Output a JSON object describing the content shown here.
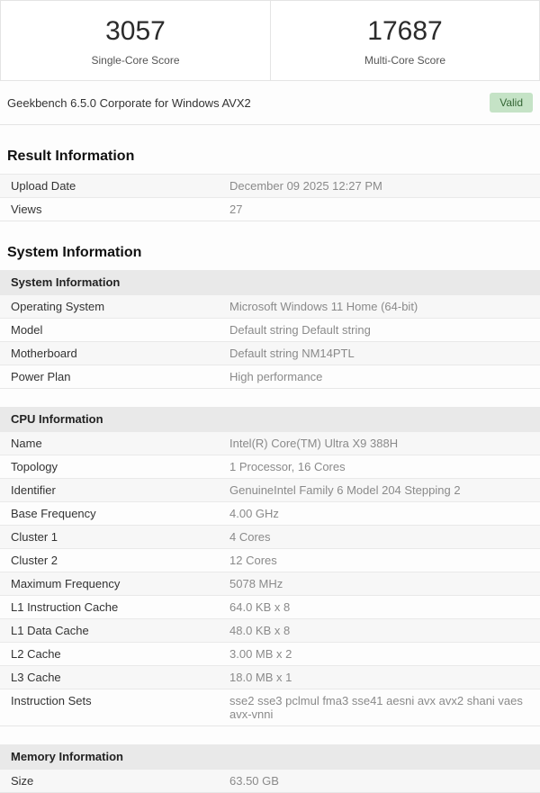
{
  "scores": {
    "single": {
      "value": "3057",
      "label": "Single-Core Score"
    },
    "multi": {
      "value": "17687",
      "label": "Multi-Core Score"
    }
  },
  "caption": {
    "text": "Geekbench 6.5.0 Corporate for Windows AVX2",
    "badge": "Valid"
  },
  "colors": {
    "badge_bg": "#c5e3c6",
    "badge_text": "#356635",
    "table_bar_bg": "#e9e9e9",
    "stripe_bg": "#f7f7f7"
  },
  "result_section": {
    "title": "Result Information",
    "rows": [
      {
        "label": "Upload Date",
        "value": "December 09 2025 12:27 PM"
      },
      {
        "label": "Views",
        "value": "27"
      }
    ]
  },
  "system_section": {
    "title": "System Information",
    "system_table": {
      "header": "System Information",
      "rows": [
        {
          "label": "Operating System",
          "value": "Microsoft Windows 11 Home (64-bit)"
        },
        {
          "label": "Model",
          "value": "Default string Default string"
        },
        {
          "label": "Motherboard",
          "value": "Default string NM14PTL"
        },
        {
          "label": "Power Plan",
          "value": "High performance"
        }
      ]
    },
    "cpu_table": {
      "header": "CPU Information",
      "rows": [
        {
          "label": "Name",
          "value": "Intel(R) Core(TM) Ultra X9 388H"
        },
        {
          "label": "Topology",
          "value": "1 Processor, 16 Cores"
        },
        {
          "label": "Identifier",
          "value": "GenuineIntel Family 6 Model 204 Stepping 2"
        },
        {
          "label": "Base Frequency",
          "value": "4.00 GHz"
        },
        {
          "label": "Cluster 1",
          "value": "4 Cores"
        },
        {
          "label": "Cluster 2",
          "value": "12 Cores"
        },
        {
          "label": "Maximum Frequency",
          "value": "5078 MHz"
        },
        {
          "label": "L1 Instruction Cache",
          "value": "64.0 KB x 8"
        },
        {
          "label": "L1 Data Cache",
          "value": "48.0 KB x 8"
        },
        {
          "label": "L2 Cache",
          "value": "3.00 MB x 2"
        },
        {
          "label": "L3 Cache",
          "value": "18.0 MB x 1"
        },
        {
          "label": "Instruction Sets",
          "value": "sse2 sse3 pclmul fma3 sse41 aesni avx avx2 shani vaes avx-vnni"
        }
      ]
    },
    "memory_table": {
      "header": "Memory Information",
      "rows": [
        {
          "label": "Size",
          "value": "63.50 GB"
        }
      ]
    }
  }
}
